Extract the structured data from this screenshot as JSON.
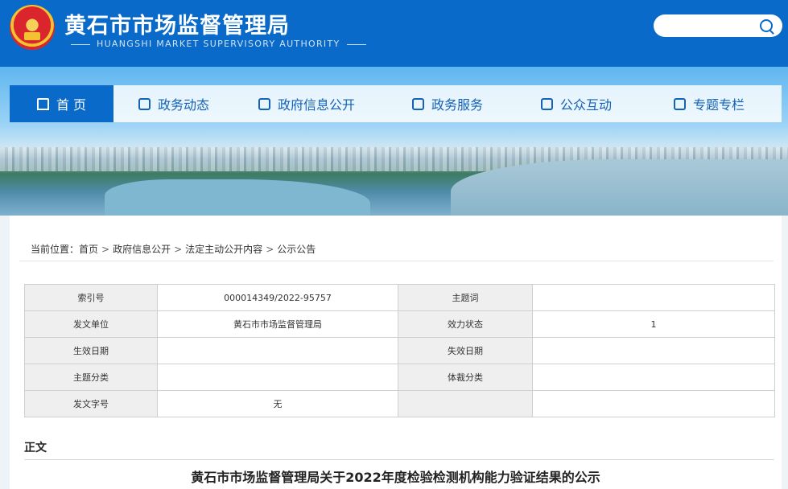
{
  "header": {
    "title": "黄石市市场监督管理局",
    "subtitle": "HUANGSHI MARKET SUPERVISORY AUTHORITY",
    "search_placeholder": ""
  },
  "nav": [
    {
      "label": "首 页",
      "icon": "home-icon",
      "active": true
    },
    {
      "label": "政务动态",
      "icon": "document-icon"
    },
    {
      "label": "政府信息公开",
      "icon": "info-panel-icon"
    },
    {
      "label": "政务服务",
      "icon": "chat-icon"
    },
    {
      "label": "公众互动",
      "icon": "bookmark-icon"
    },
    {
      "label": "专题专栏",
      "icon": "book-icon"
    }
  ],
  "breadcrumb": {
    "prefix": "当前位置：",
    "items": [
      "首页",
      "政府信息公开",
      "法定主动公开内容",
      "公示公告"
    ],
    "separator": ">"
  },
  "meta_table": [
    [
      "索引号",
      "000014349/2022-95757",
      "主题词",
      ""
    ],
    [
      "发文单位",
      "黄石市市场监督管理局",
      "效力状态",
      "1"
    ],
    [
      "生效日期",
      "",
      "失效日期",
      ""
    ],
    [
      "主题分类",
      "",
      "体裁分类",
      ""
    ],
    [
      "发文字号",
      "无",
      "",
      ""
    ]
  ],
  "section_title": "正文",
  "document_title": "黄石市市场监督管理局关于2022年度检验检测机构能力验证结果的公示",
  "colors": {
    "brand": "#0a6ac9",
    "nav_text": "#1462b7"
  }
}
